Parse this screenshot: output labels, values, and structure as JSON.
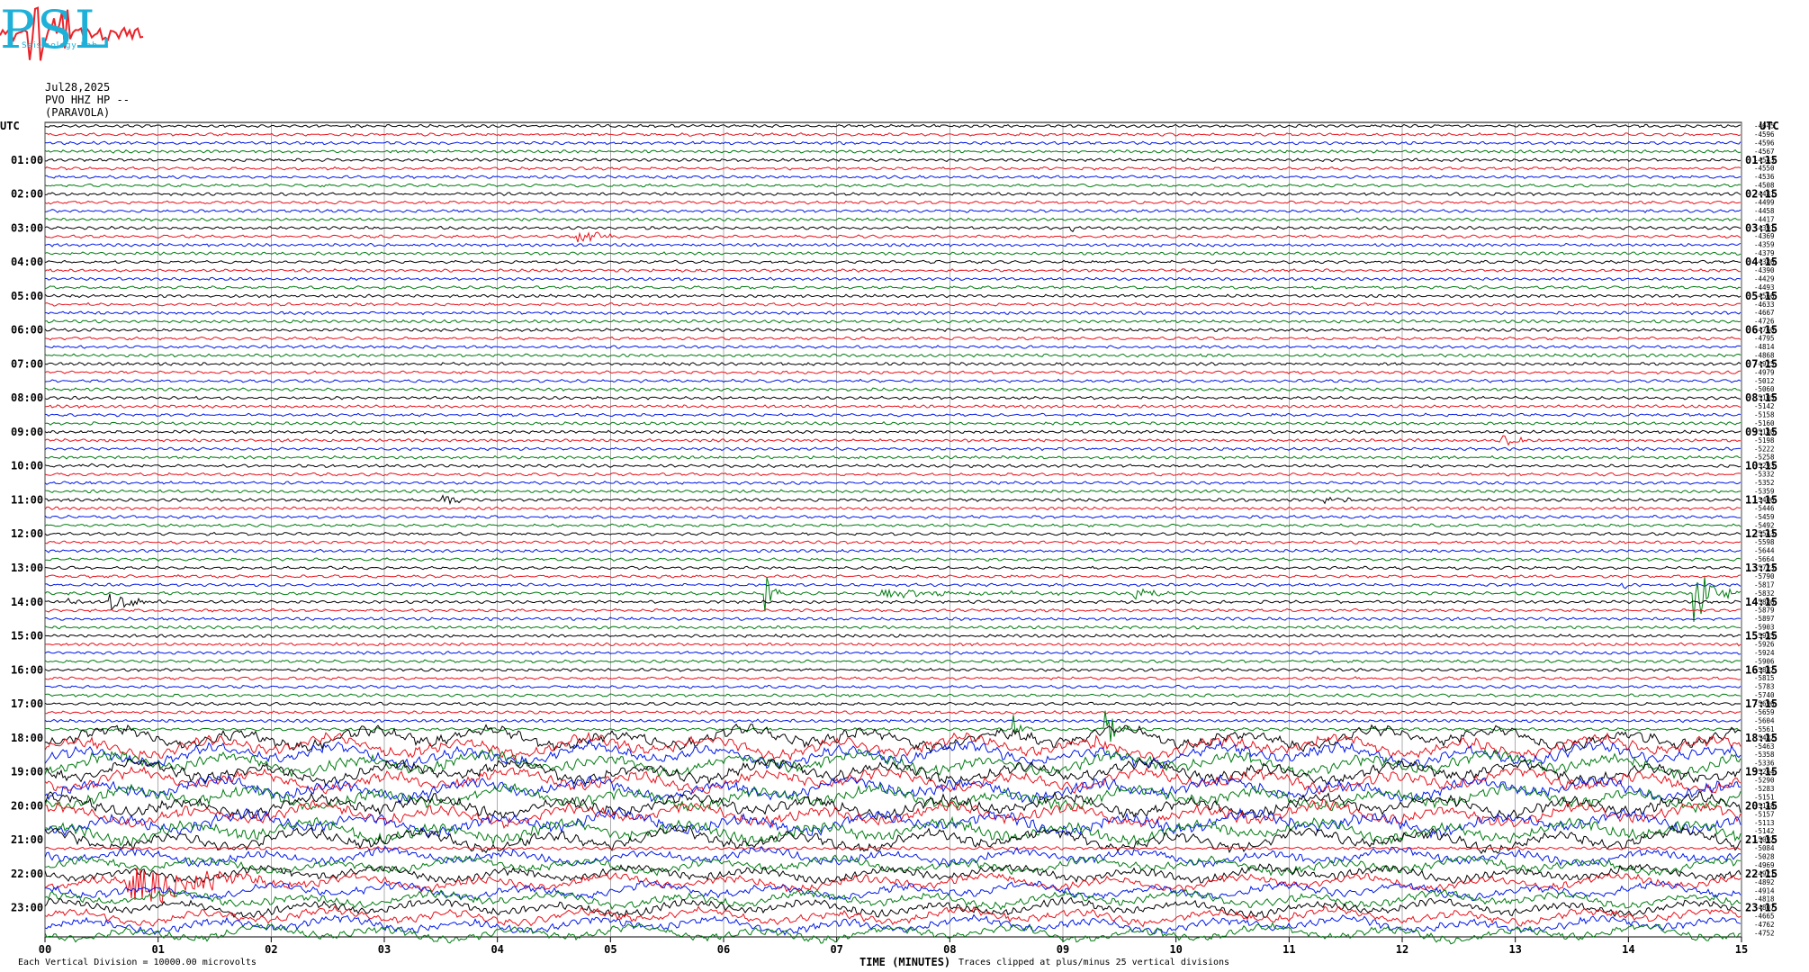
{
  "header": {
    "date": "Jul28,2025",
    "station": "PVO HHZ HP --",
    "location": "(PARAVOLA)"
  },
  "logo": {
    "letters": "PSL",
    "subtitle": "Seismology Lab",
    "wave_color": "#e8242a",
    "text_color": "#1fb0d8"
  },
  "footer": {
    "left_note": "Each Vertical Division = 10000.00 microvolts",
    "right_note": "Traces clipped at plus/minus 25 vertical divisions"
  },
  "chart_data": {
    "type": "line",
    "xlabel": "TIME (MINUTES)",
    "xlim": [
      0,
      15
    ],
    "x_ticks": [
      "00",
      "01",
      "02",
      "03",
      "04",
      "05",
      "06",
      "07",
      "08",
      "09",
      "10",
      "11",
      "12",
      "13",
      "14",
      "15"
    ],
    "left_axis_title": "UTC",
    "right_axis_title": "UTC",
    "left_hour_labels": [
      "01:00",
      "02:00",
      "03:00",
      "04:00",
      "05:00",
      "06:00",
      "07:00",
      "08:00",
      "09:00",
      "10:00",
      "11:00",
      "12:00",
      "13:00",
      "14:00",
      "15:00",
      "16:00",
      "17:00",
      "18:00",
      "19:00",
      "20:00",
      "21:00",
      "22:00",
      "23:00"
    ],
    "right_hour_labels": [
      "01:15",
      "02:15",
      "03:15",
      "04:15",
      "05:15",
      "06:15",
      "07:15",
      "08:15",
      "09:15",
      "10:15",
      "11:15",
      "12:15",
      "13:15",
      "14:15",
      "15:15",
      "16:15",
      "17:15",
      "18:15",
      "19:15",
      "20:15",
      "21:15",
      "22:15",
      "23:15"
    ],
    "trace_color_cycle": [
      "#000000",
      "#e8101a",
      "#0018e8",
      "#007a10"
    ],
    "trace_count": 96,
    "right_values": [
      "-4645",
      "-4596",
      "-4596",
      "-4567",
      "-4543",
      "-4550",
      "-4536",
      "-4508",
      "-4481",
      "-4499",
      "-4458",
      "-4417",
      "-4391",
      "-4369",
      "-4359",
      "-4379",
      "-4386",
      "-4390",
      "-4429",
      "-4493",
      "-4566",
      "-4633",
      "-4667",
      "-4726",
      "-4760",
      "-4795",
      "-4814",
      "-4868",
      "-4925",
      "-4979",
      "-5012",
      "-5060",
      "-5105",
      "-5142",
      "-5158",
      "-5160",
      "-5180",
      "-5198",
      "-5222",
      "-5258",
      "-5293",
      "-5332",
      "-5352",
      "-5359",
      "-5406",
      "-5446",
      "-5459",
      "-5492",
      "-5543",
      "-5598",
      "-5644",
      "-5664",
      "-5723",
      "-5790",
      "-5817",
      "-5832",
      "-5886",
      "-5879",
      "-5897",
      "-5903",
      "-5935",
      "-5926",
      "-5924",
      "-5906",
      "-5882",
      "-5815",
      "-5783",
      "-5740",
      "-5696",
      "-5659",
      "-5604",
      "-5561",
      "-5482",
      "-5463",
      "-5358",
      "-5336",
      "-5264",
      "-5290",
      "-5283",
      "-5151",
      "-5148",
      "-5157",
      "-5113",
      "-5142",
      "-5092",
      "-5084",
      "-5028",
      "-4969",
      "-4921",
      "-4892",
      "-4914",
      "-4818",
      "-4807",
      "-4665",
      "-4762",
      "-4752"
    ],
    "events": [
      {
        "trace": 13,
        "minute": 4.7,
        "amp": 14,
        "dur": 0.4
      },
      {
        "trace": 12,
        "minute": 9.05,
        "amp": 6,
        "dur": 0.3
      },
      {
        "trace": 37,
        "minute": 12.85,
        "amp": 8,
        "dur": 0.5
      },
      {
        "trace": 40,
        "minute": 0.3,
        "amp": 3,
        "dur": 0.3
      },
      {
        "trace": 44,
        "minute": 3.5,
        "amp": 8,
        "dur": 0.4
      },
      {
        "trace": 44,
        "minute": 11.3,
        "amp": 6,
        "dur": 0.4
      },
      {
        "trace": 56,
        "minute": 0.55,
        "amp": 12,
        "dur": 0.6
      },
      {
        "trace": 56,
        "minute": 0.2,
        "amp": 6,
        "dur": 0.2
      },
      {
        "trace": 55,
        "minute": 7.3,
        "amp": 5,
        "dur": 2.6
      },
      {
        "trace": 55,
        "minute": 6.35,
        "amp": 60,
        "dur": 0.15
      },
      {
        "trace": 55,
        "minute": 9.6,
        "amp": 10,
        "dur": 0.6
      },
      {
        "trace": 54,
        "minute": 13.9,
        "amp": 5,
        "dur": 0.4
      },
      {
        "trace": 55,
        "minute": 14.55,
        "amp": 40,
        "dur": 0.5
      },
      {
        "trace": 71,
        "minute": 8.55,
        "amp": 22,
        "dur": 0.2
      },
      {
        "trace": 71,
        "minute": 9.35,
        "amp": 38,
        "dur": 0.25
      },
      {
        "trace": 73,
        "minute": 9.2,
        "amp": 5,
        "dur": 1.5
      },
      {
        "trace": 86,
        "minute": 3.0,
        "amp": 3,
        "dur": 0.5
      },
      {
        "trace": 89,
        "minute": 0.7,
        "amp": 30,
        "dur": 1.8
      }
    ],
    "grid": true
  }
}
